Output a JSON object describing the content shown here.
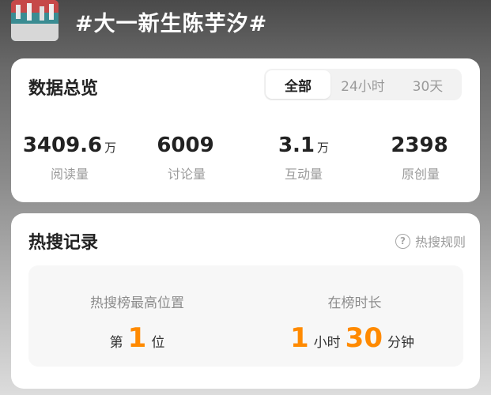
{
  "header": {
    "topic_title": "#大一新生陈芋汐#"
  },
  "overview": {
    "title": "数据总览",
    "tabs": [
      {
        "label": "全部",
        "active": true
      },
      {
        "label": "24小时",
        "active": false
      },
      {
        "label": "30天",
        "active": false
      }
    ],
    "stats": [
      {
        "value": "3409.6",
        "unit": "万",
        "label": "阅读量"
      },
      {
        "value": "6009",
        "unit": "",
        "label": "讨论量"
      },
      {
        "value": "3.1",
        "unit": "万",
        "label": "互动量"
      },
      {
        "value": "2398",
        "unit": "",
        "label": "原创量"
      }
    ]
  },
  "hot_search": {
    "title": "热搜记录",
    "rules_label": "热搜规则",
    "highest_position": {
      "label": "热搜榜最高位置",
      "prefix": "第",
      "value": "1",
      "suffix": "位"
    },
    "duration": {
      "label": "在榜时长",
      "hours": "1",
      "hours_unit": "小时",
      "minutes": "30",
      "minutes_unit": "分钟"
    }
  },
  "colors": {
    "accent": "#ff8a00",
    "muted_text": "#9a9a9a",
    "card_bg": "#ffffff"
  }
}
